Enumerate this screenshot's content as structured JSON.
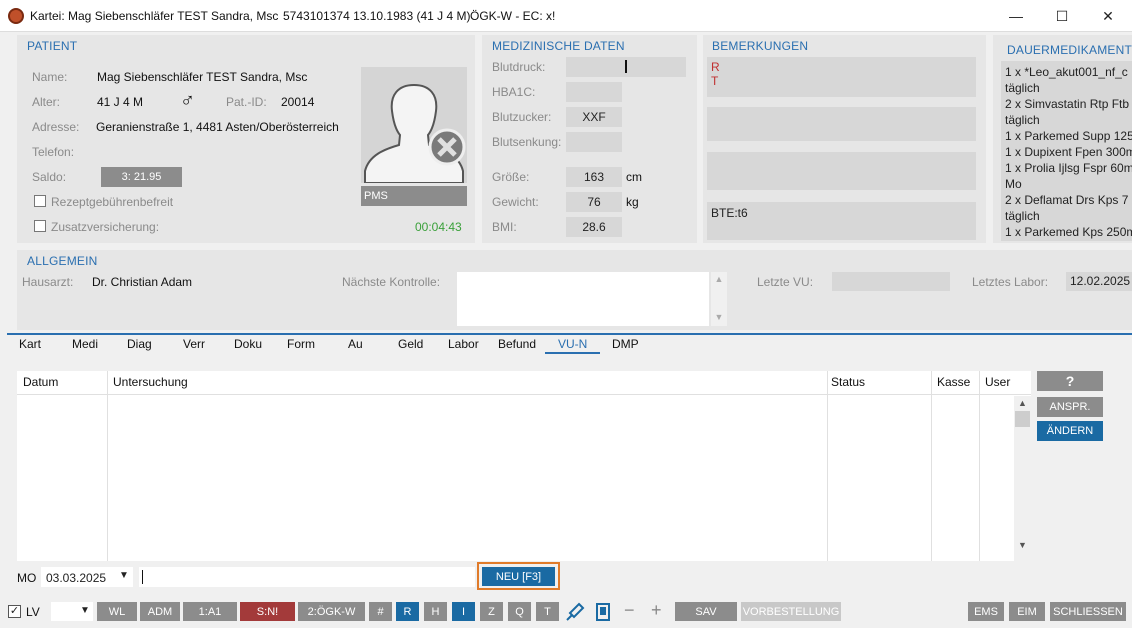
{
  "titlebar": {
    "title": "Kartei: Mag Siebenschläfer TEST Sandra, Msc",
    "info": "5743101374 13.10.1983 (41 J 4 M)",
    "insurance": "ÖGK-W - EC: x!"
  },
  "patient": {
    "header": "PATIENT",
    "name_label": "Name:",
    "name": "Mag Siebenschläfer TEST Sandra, Msc",
    "age_label": "Alter:",
    "age": "41 J 4 M",
    "patid_label": "Pat.-ID:",
    "patid": "20014",
    "address_label": "Adresse:",
    "address": "Geranienstraße 1, 4481 Asten/Oberösterreich",
    "phone_label": "Telefon:",
    "balance_label": "Saldo:",
    "balance": "3: 21.95",
    "rx_label": "Rezeptgebührenbefreit",
    "insurance_label": "Zusatzversicherung:",
    "pms": "PMS",
    "timer": "00:04:43"
  },
  "med": {
    "header": "MEDIZINISCHE DATEN",
    "bp_label": "Blutdruck:",
    "hba1c_label": "HBA1C:",
    "sugar_label": "Blutzucker:",
    "sugar": "XXF",
    "bsg_label": "Blutsenkung:",
    "height_label": "Größe:",
    "height": "163",
    "height_unit": "cm",
    "weight_label": "Gewicht:",
    "weight": "76",
    "weight_unit": "kg",
    "bmi_label": "BMI:",
    "bmi": "28.6"
  },
  "remarks": {
    "header": "BEMERKUNGEN",
    "r1": "R",
    "r2": "T",
    "bte": "BTE:t6"
  },
  "permmed": {
    "header": "DAUERMEDIKAMENTE",
    "lines": [
      "1 x *Leo_akut001_nf_c",
      "täglich",
      "2 x Simvastatin Rtp Ftb",
      "täglich",
      "1 x Parkemed Supp 125",
      "1 x Dupixent Fpen 300m",
      "1 x Prolia Ijlsg Fspr 60m",
      "Mo",
      "2 x Deflamat Drs Kps  7",
      "täglich",
      "1 x Parkemed Kps 250m"
    ]
  },
  "general": {
    "header": "ALLGEMEIN",
    "gp_label": "Hausarzt:",
    "gp": "Dr. Christian Adam",
    "next_label": "Nächste Kontrolle:",
    "lastvu_label": "Letzte VU:",
    "lastlab_label": "Letztes Labor:",
    "lastlab": "12.02.2025"
  },
  "tabs": [
    "Kart",
    "Medi",
    "Diag",
    "Verr",
    "Doku",
    "Form",
    "Au",
    "Geld",
    "Labor",
    "Befund",
    "VU-N",
    "DMP"
  ],
  "table": {
    "headers": [
      "Datum",
      "Untersuchung",
      "Status",
      "Kasse",
      "User"
    ]
  },
  "side": {
    "help": "?",
    "anspr": "ANSPR.",
    "aendern": "ÄNDERN"
  },
  "entry": {
    "mo": "MO",
    "date": "03.03.2025",
    "new": "NEU [F3]"
  },
  "toolbar": {
    "lv": "LV",
    "wl": "WL",
    "adm": "ADM",
    "a1": "1:A1",
    "sn": "S:N!",
    "ogk": "2:ÖGK-W",
    "hash": "#",
    "r": "R",
    "h": "H",
    "i": "I",
    "z": "Z",
    "q": "Q",
    "t": "T",
    "minus": "−",
    "plus": "+",
    "sav": "SAV",
    "vorbest": "VORBESTELLUNG",
    "ems": "EMS",
    "eim": "EIM",
    "close": "SCHLIESSEN"
  }
}
